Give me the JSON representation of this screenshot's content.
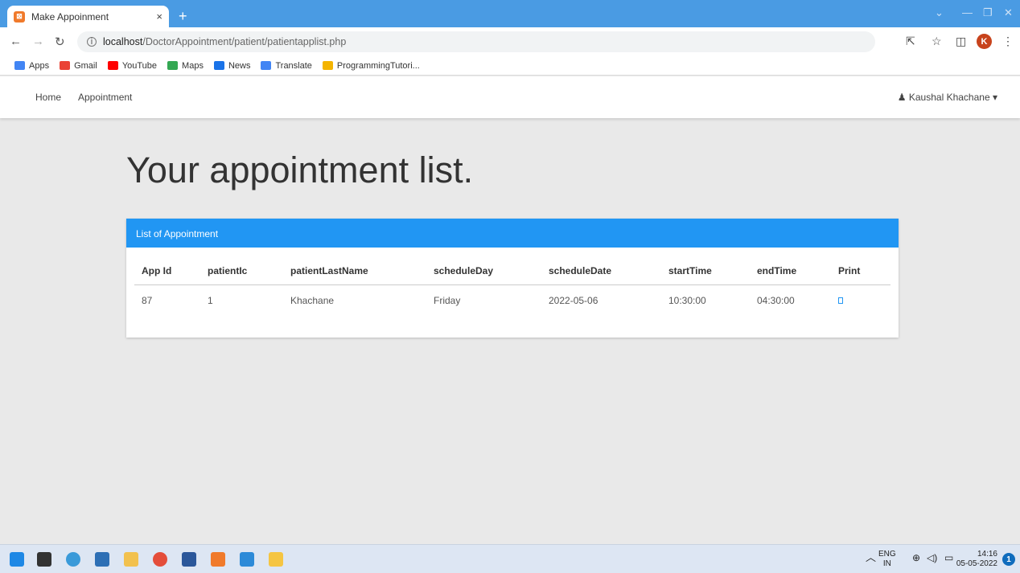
{
  "browser": {
    "tab_title": "Make Appoinment",
    "tab_close": "×",
    "new_tab": "+",
    "url_host": "localhost",
    "url_path": "/DoctorAppointment/patient/patientapplist.php",
    "profile_initial": "K",
    "bookmarks": [
      {
        "label": "Apps",
        "color": "#4285f4"
      },
      {
        "label": "Gmail",
        "color": "#ea4335"
      },
      {
        "label": "YouTube",
        "color": "#ff0000"
      },
      {
        "label": "Maps",
        "color": "#34a853"
      },
      {
        "label": "News",
        "color": "#1a73e8"
      },
      {
        "label": "Translate",
        "color": "#4285f4"
      },
      {
        "label": "ProgrammingTutori...",
        "color": "#f4b400"
      }
    ]
  },
  "navbar": {
    "home": "Home",
    "appointment": "Appointment",
    "user": "Kaushal Khachane"
  },
  "page": {
    "heading": "Your appointment list.",
    "panel_title": "List of Appointment",
    "columns": [
      "App Id",
      "patientIc",
      "patientLastName",
      "scheduleDay",
      "scheduleDate",
      "startTime",
      "endTime",
      "Print"
    ],
    "rows": [
      {
        "app_id": "87",
        "patient_ic": "1",
        "last_name": "Khachane",
        "day": "Friday",
        "date": "2022-05-06",
        "start": "10:30:00",
        "end": "04:30:00"
      }
    ]
  },
  "taskbar": {
    "lang_top": "ENG",
    "lang_bottom": "IN",
    "time": "14:16",
    "date": "05-05-2022",
    "notifications": "1"
  },
  "colors": {
    "accent": "#2196f3",
    "tabbar": "#4a9be3"
  }
}
